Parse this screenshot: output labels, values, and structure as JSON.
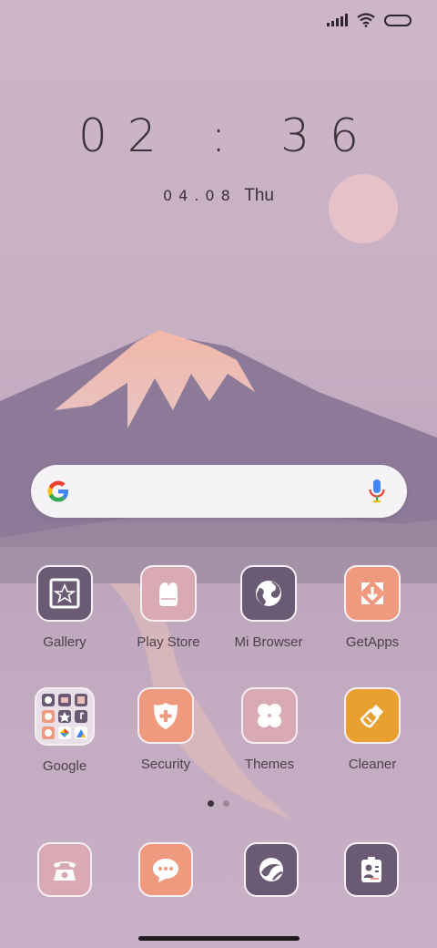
{
  "status_bar": {
    "signal": "signal-icon",
    "wifi": "wifi-icon",
    "battery": "battery-icon"
  },
  "clock": {
    "time": "02 : 36",
    "date": "04.08",
    "weekday": "Thu"
  },
  "search": {
    "logo": "google-logo-icon",
    "mic": "mic-icon"
  },
  "apps": [
    {
      "label": "Gallery",
      "icon": "gallery-icon",
      "color": "#6b5a74"
    },
    {
      "label": "Play Store",
      "icon": "play-store-icon",
      "color": "#d9aab4"
    },
    {
      "label": "Mi Browser",
      "icon": "browser-globe-icon",
      "color": "#6b5a74"
    },
    {
      "label": "GetApps",
      "icon": "getapps-icon",
      "color": "#ef9a7e"
    },
    {
      "label": "Google",
      "icon": "google-folder-icon",
      "color": "#e8dfe8"
    },
    {
      "label": "Security",
      "icon": "security-shield-icon",
      "color": "#ef9a7e"
    },
    {
      "label": "Themes",
      "icon": "themes-clover-icon",
      "color": "#d9aab4"
    },
    {
      "label": "Cleaner",
      "icon": "cleaner-brush-icon",
      "color": "#e8a030"
    }
  ],
  "dock": [
    {
      "icon": "phone-icon",
      "color": "#d9aab4"
    },
    {
      "icon": "messages-icon",
      "color": "#ef9a7e"
    },
    {
      "icon": "camera-icon",
      "color": "#6b5a74"
    },
    {
      "icon": "contacts-icon",
      "color": "#6b5a74"
    }
  ],
  "page_indicator": {
    "count": 2,
    "active": 1
  }
}
